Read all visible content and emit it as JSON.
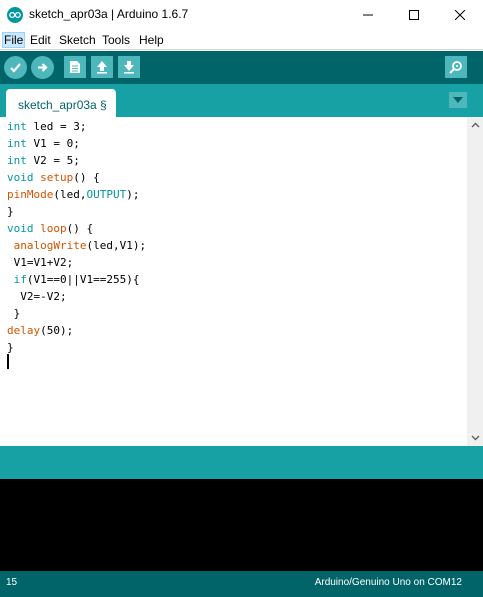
{
  "window": {
    "title": "sketch_apr03a | Arduino 1.6.7",
    "app_icon": "arduino-logo-icon",
    "controls": [
      "minimize-icon",
      "maximize-icon",
      "close-icon"
    ]
  },
  "menu": {
    "items": [
      "File",
      "Edit",
      "Sketch",
      "Tools",
      "Help"
    ]
  },
  "toolbar": {
    "buttons": [
      {
        "name": "verify",
        "icon": "check-icon"
      },
      {
        "name": "upload",
        "icon": "arrow-right-icon"
      },
      {
        "name": "new",
        "icon": "document-icon"
      },
      {
        "name": "open",
        "icon": "arrow-up-icon"
      },
      {
        "name": "save",
        "icon": "arrow-down-icon"
      },
      {
        "name": "serial-monitor",
        "icon": "magnifier-icon"
      }
    ]
  },
  "tabs": {
    "active_tab": "sketch_apr03a §",
    "menu_icon": "triangle-down-icon"
  },
  "code": {
    "lines": [
      "int led = 3;",
      "int V1 = 0;",
      "int V2 = 5;",
      "void setup() {",
      "pinMode(led,OUTPUT);",
      "}",
      "void loop() {",
      " analogWrite(led,V1);",
      " V1=V1+V2;",
      " if(V1==0||V1==255){",
      "  V2=-V2;",
      " }",
      "delay(50);",
      "}"
    ]
  },
  "status": {
    "line_number": "15",
    "board": "Arduino/Genuino Uno on COM12"
  },
  "colors": {
    "accent_dark": "#006468",
    "accent_mid": "#17a1a5",
    "button": "#4db7bb",
    "keyword": "#00979c",
    "function": "#d35400"
  }
}
